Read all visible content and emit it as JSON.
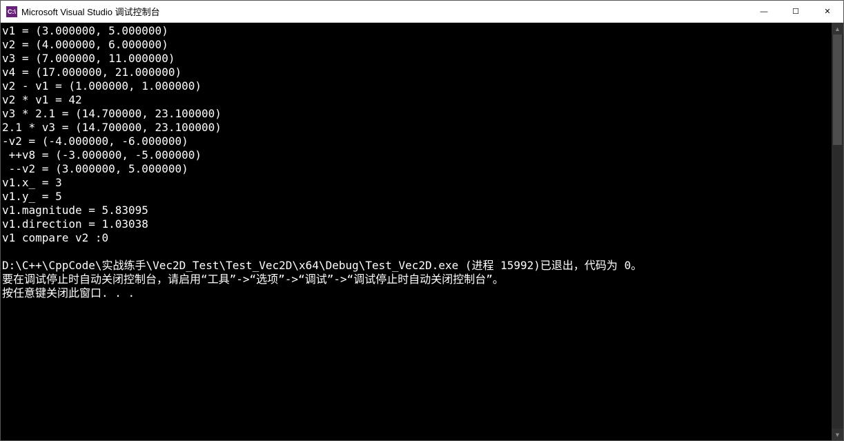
{
  "window": {
    "icon_label": "C:\\",
    "title": "Microsoft Visual Studio 调试控制台"
  },
  "controls": {
    "minimize": "—",
    "maximize": "☐",
    "close": "✕"
  },
  "console": {
    "lines": [
      "v1 = (3.000000, 5.000000)",
      "v2 = (4.000000, 6.000000)",
      "v3 = (7.000000, 11.000000)",
      "v4 = (17.000000, 21.000000)",
      "v2 - v1 = (1.000000, 1.000000)",
      "v2 * v1 = 42",
      "v3 * 2.1 = (14.700000, 23.100000)",
      "2.1 * v3 = (14.700000, 23.100000)",
      "-v2 = (-4.000000, -6.000000)",
      " ++v8 = (-3.000000, -5.000000)",
      " --v2 = (3.000000, 5.000000)",
      "v1.x_ = 3",
      "v1.y_ = 5",
      "v1.magnitude = 5.83095",
      "v1.direction = 1.03038",
      "v1 compare v2 :0",
      "",
      "D:\\C++\\CppCode\\实战练手\\Vec2D_Test\\Test_Vec2D\\x64\\Debug\\Test_Vec2D.exe (进程 15992)已退出，代码为 0。",
      "要在调试停止时自动关闭控制台，请启用“工具”->“选项”->“调试”->“调试停止时自动关闭控制台”。",
      "按任意键关闭此窗口. . ."
    ]
  },
  "scroll": {
    "up": "▲",
    "down": "▼"
  }
}
